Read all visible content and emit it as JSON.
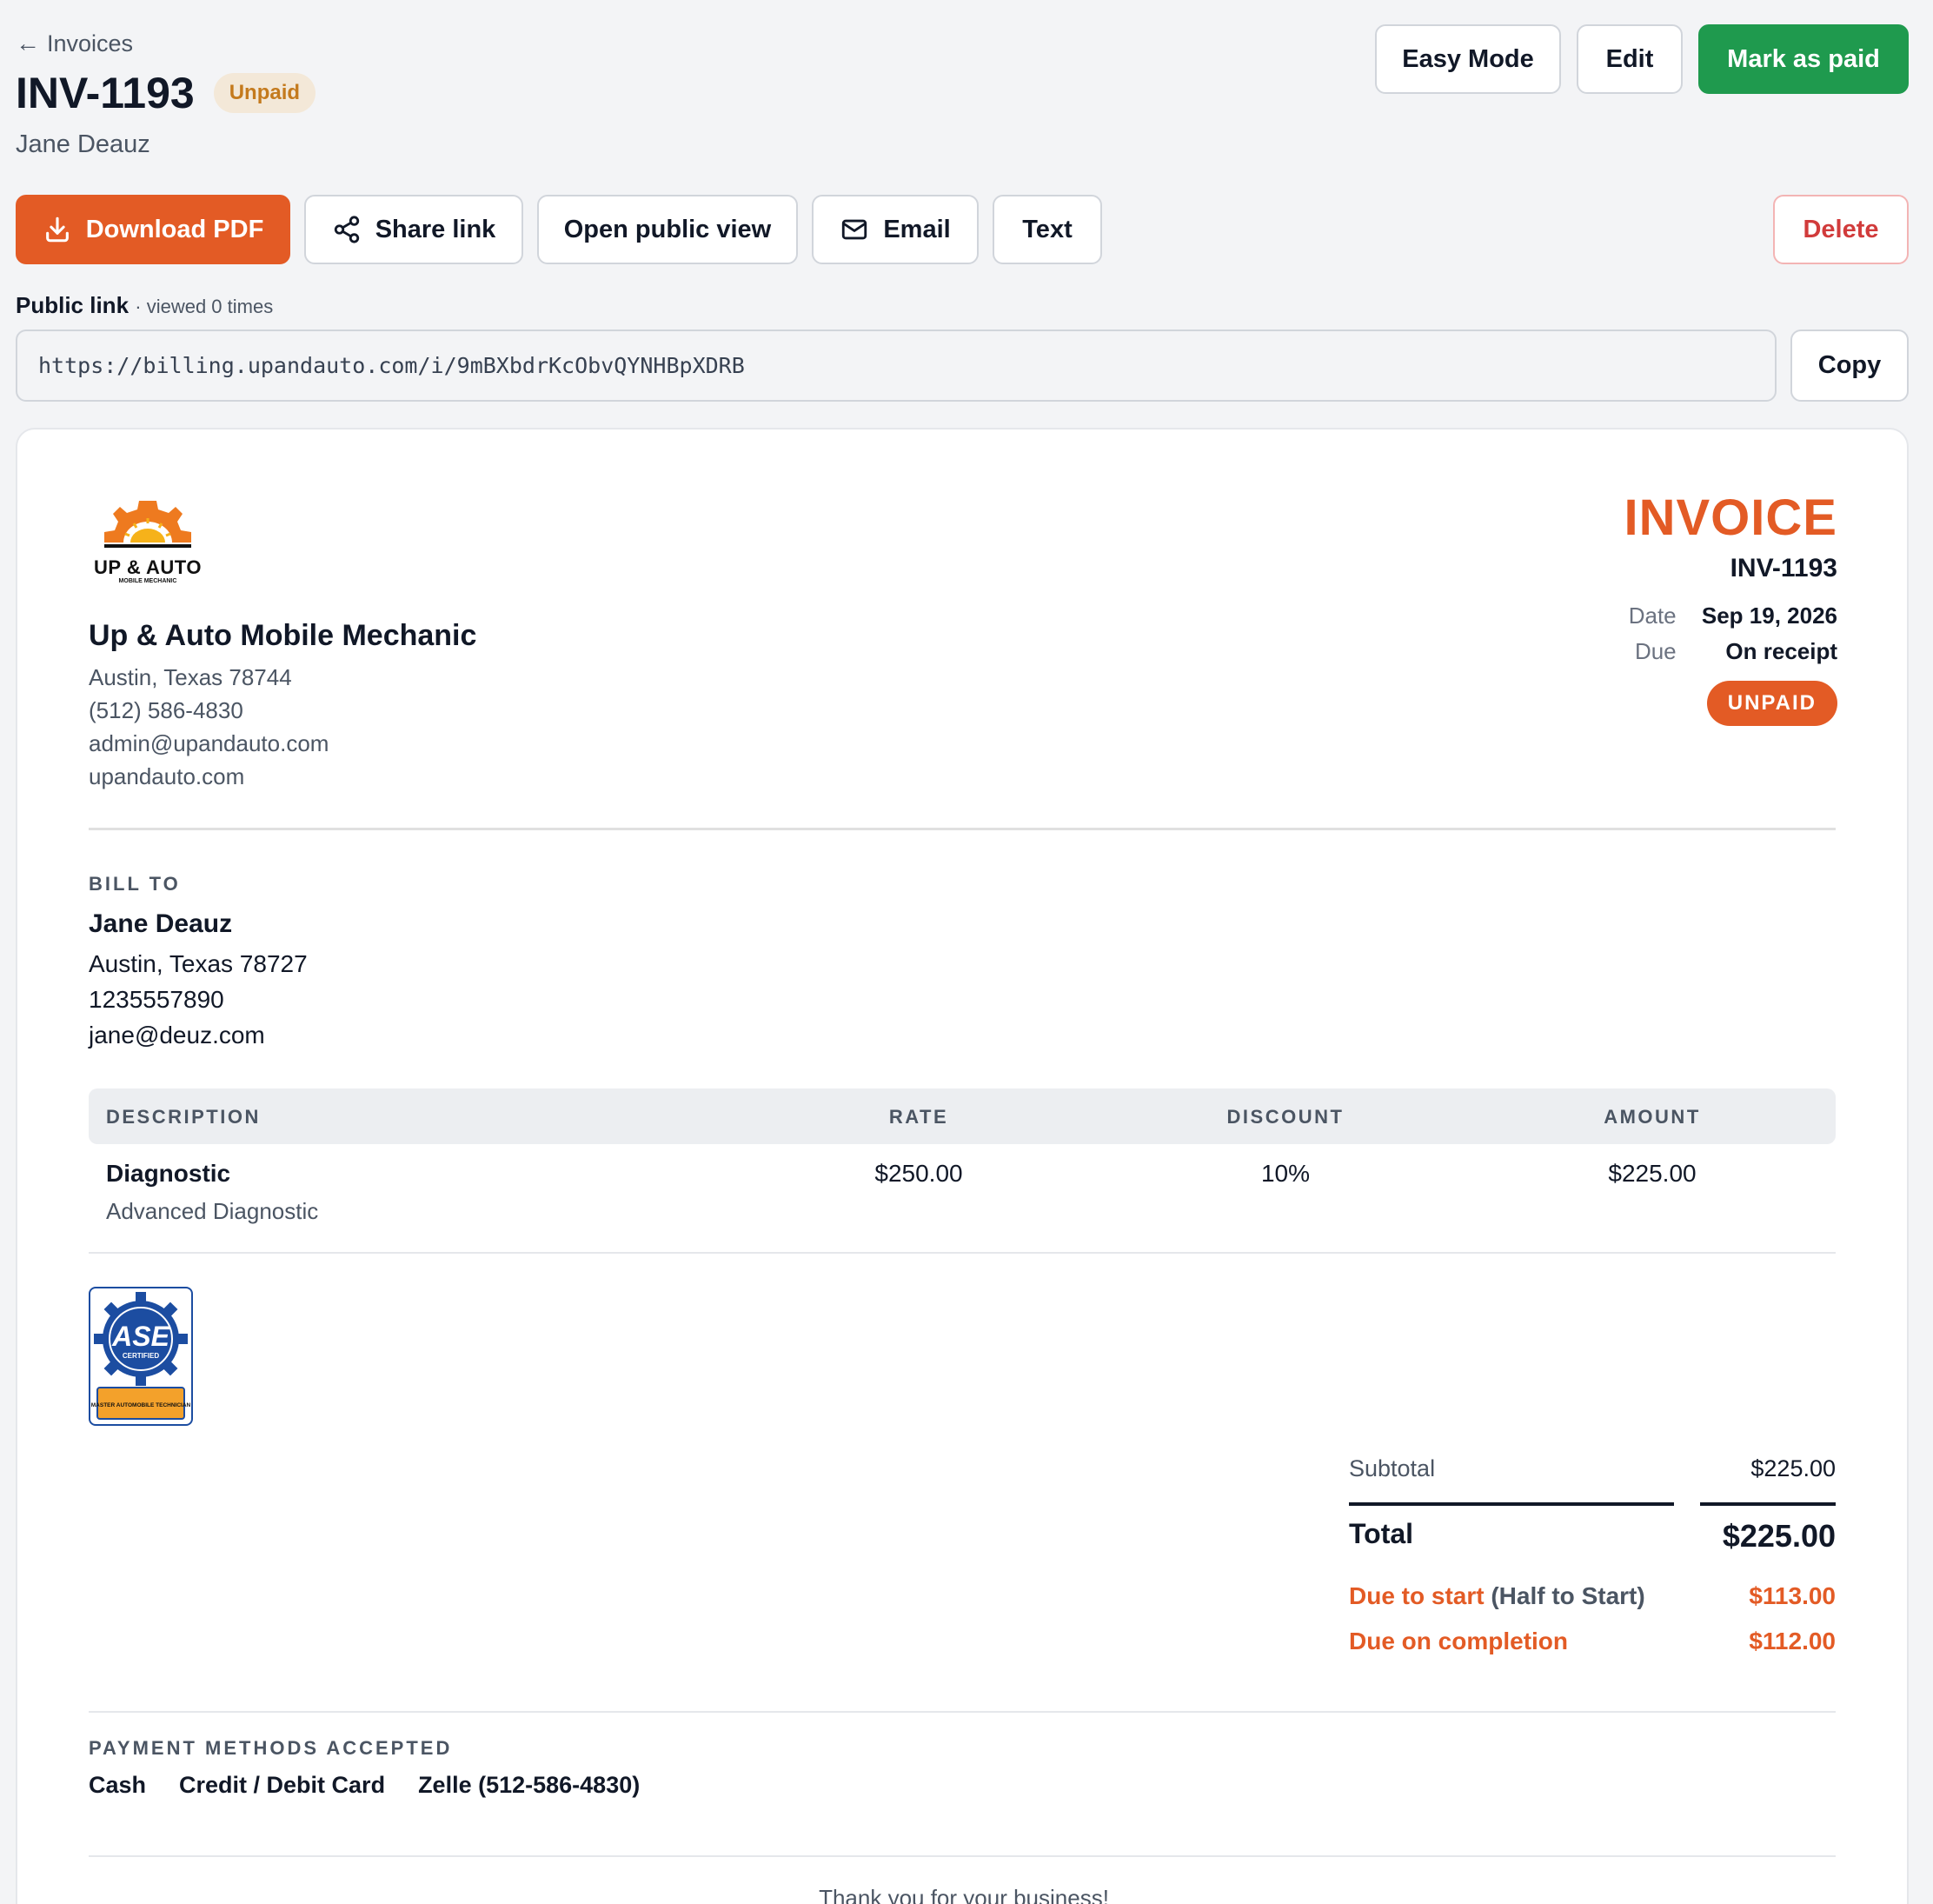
{
  "header": {
    "back_label": "Invoices",
    "title": "INV-1193",
    "status": "Unpaid",
    "client": "Jane Deauz"
  },
  "top_actions": {
    "easy_mode": "Easy Mode",
    "edit": "Edit",
    "mark_paid": "Mark as paid"
  },
  "actions": {
    "download_pdf": "Download PDF",
    "share_link": "Share link",
    "open_public": "Open public view",
    "email": "Email",
    "text": "Text",
    "delete": "Delete"
  },
  "public_link": {
    "label": "Public link",
    "meta": "· viewed 0 times",
    "url": "https://billing.upandauto.com/i/9mBXbdrKcObvQYNHBpXDRB",
    "copy": "Copy"
  },
  "business": {
    "logo_text": "UP & AUTO",
    "logo_sub": "MOBILE MECHANIC",
    "name": "Up & Auto Mobile Mechanic",
    "address": "Austin, Texas 78744",
    "phone": "(512) 586-4830",
    "email": "admin@upandauto.com",
    "website": "upandauto.com"
  },
  "invoice": {
    "word": "INVOICE",
    "number": "INV-1193",
    "date_label": "Date",
    "date": "Sep 19, 2026",
    "due_label": "Due",
    "due": "On receipt",
    "badge": "UNPAID"
  },
  "bill_to": {
    "label": "BILL TO",
    "name": "Jane Deauz",
    "address": "Austin, Texas 78727",
    "phone": "1235557890",
    "email": "jane@deuz.com"
  },
  "table": {
    "headers": [
      "DESCRIPTION",
      "RATE",
      "DISCOUNT",
      "AMOUNT"
    ],
    "rows": [
      {
        "name": "Diagnostic",
        "detail": "Advanced Diagnostic",
        "rate": "$250.00",
        "discount": "10%",
        "amount": "$225.00"
      }
    ]
  },
  "certification": {
    "logo": "ASE",
    "sub": "CERTIFIED",
    "band": "MASTER AUTOMOBILE TECHNICIAN",
    "colors": {
      "blue": "#1c4da1",
      "orange": "#f3a12b"
    }
  },
  "totals": {
    "subtotal_label": "Subtotal",
    "subtotal": "$225.00",
    "total_label": "Total",
    "total": "$225.00",
    "due_start_label": "Due to start",
    "due_start_note": "(Half to Start)",
    "due_start": "$113.00",
    "due_completion_label": "Due on completion",
    "due_completion": "$112.00"
  },
  "payment": {
    "label": "PAYMENT METHODS ACCEPTED",
    "methods": [
      "Cash",
      "Credit / Debit Card",
      "Zelle (512-586-4830)"
    ]
  },
  "footer": {
    "thanks": "Thank you for your business!"
  },
  "colors": {
    "accent": "#e35b25",
    "green": "#1f9a4e",
    "danger": "#d13b3b"
  }
}
